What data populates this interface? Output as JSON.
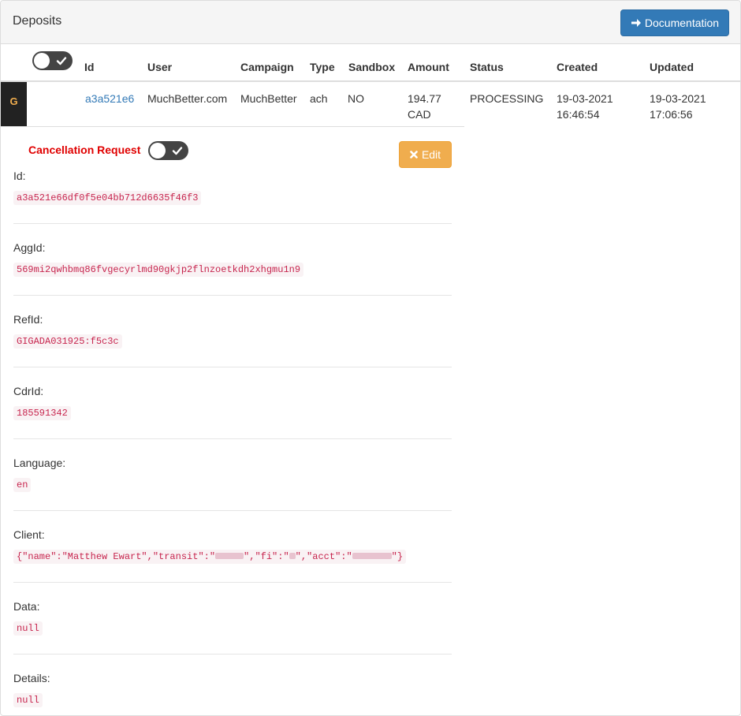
{
  "header": {
    "title": "Deposits",
    "doc_button_label": "Documentation"
  },
  "table": {
    "columns": [
      "Id",
      "User",
      "Campaign",
      "Type",
      "Sandbox",
      "Amount",
      "Status",
      "Created",
      "Updated"
    ],
    "row": {
      "marker": "G",
      "id": "a3a521e6",
      "user": "MuchBetter.com",
      "campaign": "MuchBetter",
      "type": "ach",
      "sandbox": "NO",
      "amount_value": "194.77",
      "amount_currency": "CAD",
      "status": "PROCESSING",
      "created_date": "19-03-2021",
      "created_time": "16:46:54",
      "updated_date": "19-03-2021",
      "updated_time": "17:06:56"
    }
  },
  "detail": {
    "cancellation_label": "Cancellation Request",
    "edit_label": "Edit",
    "fields": [
      {
        "label": "Id:",
        "value": "a3a521e66df0f5e04bb712d6635f46f3"
      },
      {
        "label": "AggId:",
        "value": "569mi2qwhbmq86fvgecyrlmd90gkjp2flnzoetkdh2xhgmu1n9"
      },
      {
        "label": "RefId:",
        "value": "GIGADA031925:f5c3c"
      },
      {
        "label": "CdrId:",
        "value": "185591342"
      },
      {
        "label": "Language:",
        "value": "en"
      },
      {
        "label": "Client:",
        "value_parts": [
          "{\"name\":\"Matthew Ewart\",\"transit\":\"",
          "\",\"fi\":\"",
          "\",\"acct\":\"",
          "\"}"
        ]
      },
      {
        "label": "Data:",
        "value": "null"
      },
      {
        "label": "Details:",
        "value": "null"
      }
    ]
  },
  "colors": {
    "primary": "#337ab7",
    "warning": "#f0ad4e",
    "danger_text": "#e00000",
    "code_text": "#c7254e",
    "code_bg": "#f9f2f4",
    "toggle_bg": "#444444"
  }
}
